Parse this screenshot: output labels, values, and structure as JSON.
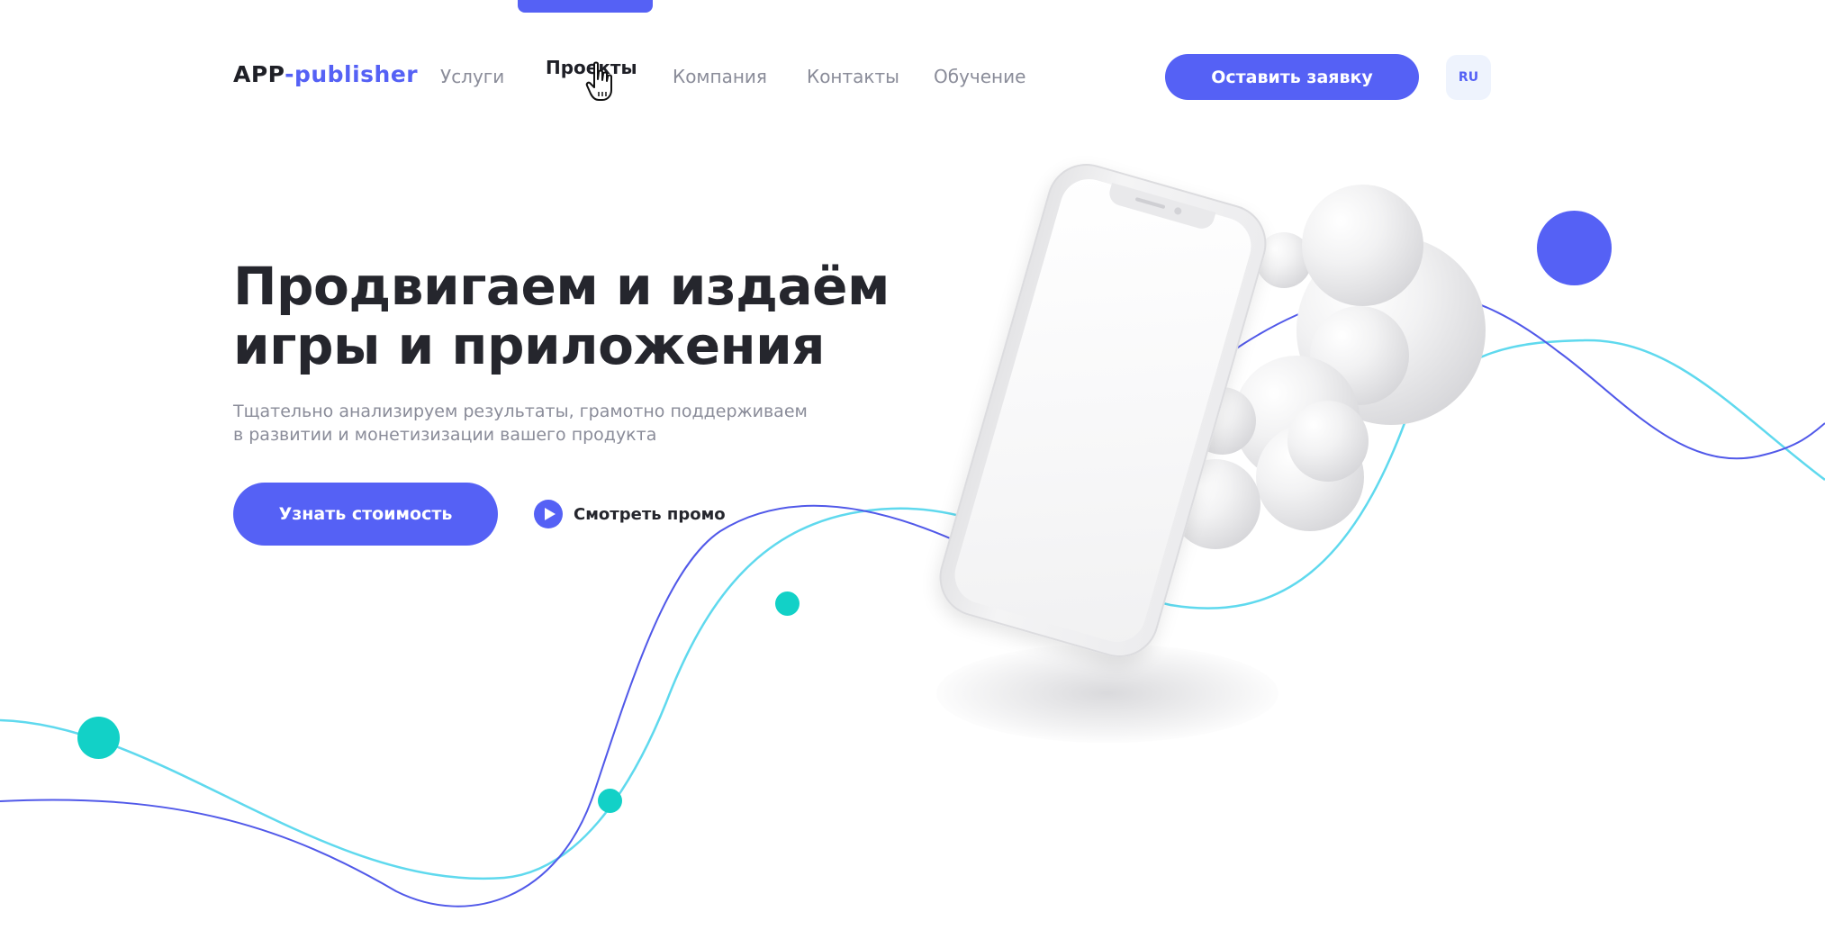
{
  "header": {
    "logo": {
      "prefix": "APP",
      "accent": "-publisher"
    },
    "nav": [
      {
        "label": "Услуги",
        "active": false
      },
      {
        "label": "Проекты",
        "active": true
      },
      {
        "label": "Компания",
        "active": false
      },
      {
        "label": "Контакты",
        "active": false
      },
      {
        "label": "Обучение",
        "active": false
      }
    ],
    "cta_label": "Оставить заявку",
    "language": "RU"
  },
  "hero": {
    "title_line1": "Продвигаем и издаём",
    "title_line2": "игры и приложения",
    "subtitle_line1": "Тщательно анализируем результаты, грамотно поддерживаем",
    "subtitle_line2": "в развитии и монетизизации вашего продукта",
    "primary_button": "Узнать стоимость",
    "promo_link": "Смотреть промо"
  },
  "icons": {
    "play": "play-icon",
    "cursor": "hand-pointer-icon"
  },
  "colors": {
    "accent": "#5561f5",
    "teal": "#12d1c7",
    "wave_cyan": "#5fd9ee",
    "text_dark": "#25262d",
    "text_muted": "#8a8c99",
    "lang_bg": "#eef3fd"
  }
}
